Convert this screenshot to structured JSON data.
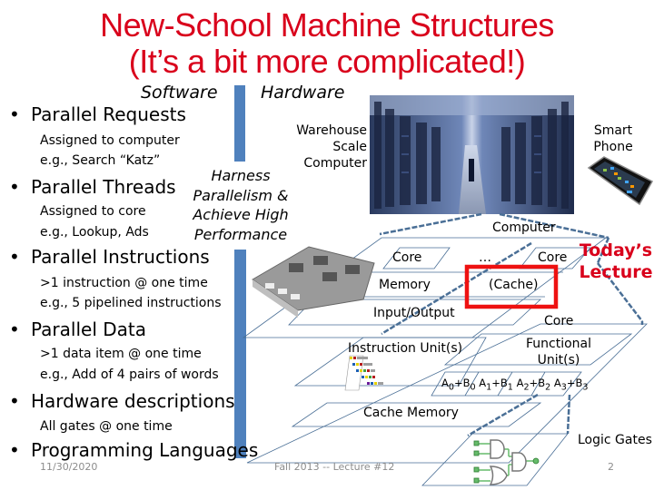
{
  "title": {
    "line1": "New-School Machine Structures",
    "line2": "(It’s a bit more complicated!)"
  },
  "headers": {
    "software": "Software",
    "hardware": "Hardware"
  },
  "harness": [
    "Harness",
    "Parallelism &",
    "Achieve High",
    "Performance"
  ],
  "bullets": [
    {
      "label": "Parallel Requests",
      "sub": [
        "Assigned to computer",
        "e.g., Search “Katz”"
      ]
    },
    {
      "label": "Parallel Threads",
      "sub": [
        "Assigned to core",
        "e.g., Lookup, Ads"
      ]
    },
    {
      "label": "Parallel Instructions",
      "sub": [
        ">1 instruction @ one time",
        "e.g., 5 pipelined instructions"
      ]
    },
    {
      "label": "Parallel Data",
      "sub": [
        ">1 data item @ one time",
        "e.g., Add of 4 pairs of words"
      ]
    },
    {
      "label": "Hardware descriptions",
      "sub": [
        "All gates @ one time"
      ]
    },
    {
      "label": "Programming Languages",
      "sub": []
    }
  ],
  "bullet_glyph": "•",
  "hardware_labels": {
    "warehouse": [
      "Warehouse",
      "Scale",
      "Computer"
    ],
    "smartphone": [
      "Smart",
      "Phone"
    ],
    "computer": "Computer",
    "core1": "Core",
    "ellipsis": "…",
    "core2": "Core",
    "memory": "Memory",
    "cache": "(Cache)",
    "io": "Input/Output",
    "core3": "Core",
    "functional": [
      "Functional",
      "Unit(s)"
    ],
    "instruction_unit": "Instruction Unit(s)",
    "adds": [
      {
        "a": "A",
        "as": "0",
        "b": "B",
        "bs": "0"
      },
      {
        "a": "A",
        "as": "1",
        "b": "B",
        "bs": "1"
      },
      {
        "a": "A",
        "as": "2",
        "b": "B",
        "bs": "2"
      },
      {
        "a": "A",
        "as": "3",
        "b": "B",
        "bs": "3"
      }
    ],
    "cache_memory": "Cache Memory",
    "logic_gates": "Logic Gates"
  },
  "callout": [
    "Today’s",
    "Lecture"
  ],
  "footer": {
    "date": "11/30/2020",
    "course": "Fall 2013 -- Lecture #12",
    "page": "2"
  },
  "colors": {
    "title_red": "#d9001b",
    "bar_blue": "#4f81bd",
    "line_blue": "#4a6f96",
    "highlight_red": "#ee1111"
  }
}
